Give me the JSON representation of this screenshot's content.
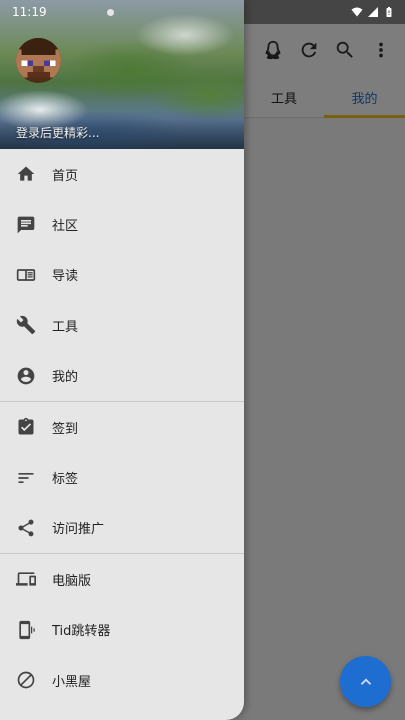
{
  "status_bar": {
    "time": "11:19"
  },
  "app": {
    "tabs": [
      {
        "label": "工具"
      },
      {
        "label": "我的"
      }
    ],
    "colors": {
      "accent": "#1f6fd6",
      "tab_indicator": "#f1c21b",
      "fab": "#1e6ed2"
    }
  },
  "drawer": {
    "login_hint": "登录后更精彩...",
    "groups": [
      [
        {
          "label": "首页",
          "icon": "home-icon"
        },
        {
          "label": "社区",
          "icon": "chat-icon"
        },
        {
          "label": "导读",
          "icon": "guide-icon"
        },
        {
          "label": "工具",
          "icon": "wrench-icon"
        },
        {
          "label": "我的",
          "icon": "account-icon"
        }
      ],
      [
        {
          "label": "签到",
          "icon": "check-clipboard-icon"
        },
        {
          "label": "标签",
          "icon": "tag-list-icon"
        },
        {
          "label": "访问推广",
          "icon": "share-icon"
        }
      ],
      [
        {
          "label": "电脑版",
          "icon": "devices-icon"
        },
        {
          "label": "Tid跳转器",
          "icon": "phone-vibrate-icon"
        },
        {
          "label": "小黑屋",
          "icon": "block-icon"
        }
      ]
    ]
  }
}
